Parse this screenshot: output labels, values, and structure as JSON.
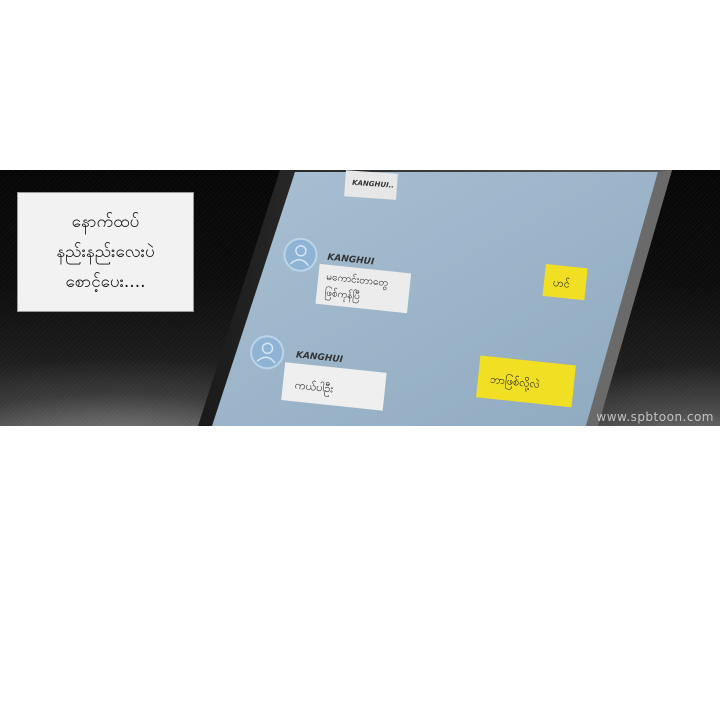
{
  "narration": {
    "lines": [
      "နောက်ထပ်",
      "နည်းနည်းလေးပဲ",
      "စောင့်ပေး...."
    ]
  },
  "chat": {
    "top_partial_name": "KANGHUI..",
    "messages": [
      {
        "sender": "KANGHUI",
        "lines": [
          "မကောင်းတာတွေ",
          "ဖြစ်ကုန်ပြီ"
        ],
        "side": "left"
      },
      {
        "text": "ဟင်",
        "side": "right"
      },
      {
        "sender": "KANGHUI",
        "lines": [
          "ကယ်ပါဦး"
        ],
        "side": "left"
      },
      {
        "text": "ဘာဖြစ်လို့လဲ",
        "side": "right"
      }
    ]
  },
  "watermark": "www.spbtoon.com",
  "colors": {
    "screen": "#9fb7cb",
    "reply_bubble": "#f2e12a",
    "incoming_bubble": "#e9e9e9",
    "phone_bezel": "#2b2b2b"
  }
}
